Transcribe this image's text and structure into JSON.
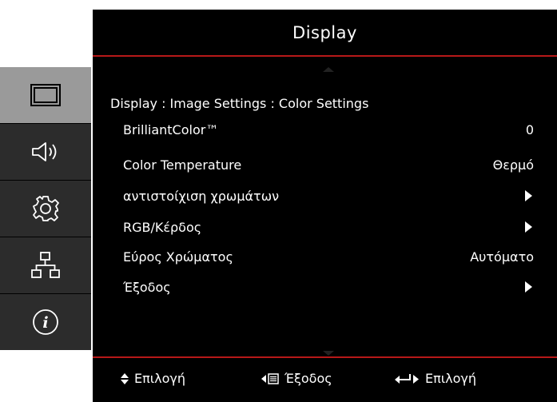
{
  "header": {
    "title": "Display"
  },
  "breadcrumb": "Display : Image Settings : Color Settings",
  "menu": [
    {
      "label": "BrilliantColor™",
      "value": "0",
      "submenu": false
    },
    {
      "label": "Color Temperature",
      "value": "Θερμό",
      "submenu": false
    },
    {
      "label": "αντιστοίχιση χρωμάτων",
      "value": "",
      "submenu": true
    },
    {
      "label": "RGB/Κέρδος",
      "value": "",
      "submenu": true
    },
    {
      "label": "Εύρος Χρώματος",
      "value": "Αυτόματο",
      "submenu": false
    },
    {
      "label": "Έξοδος",
      "value": "",
      "submenu": true
    }
  ],
  "footer": {
    "select_label": "Επιλογή",
    "exit_label": "Έξοδος",
    "enter_label": "Επιλογή"
  },
  "sidebar": {
    "items": [
      {
        "icon": "display-icon",
        "active": true
      },
      {
        "icon": "speaker-icon",
        "active": false
      },
      {
        "icon": "gear-icon",
        "active": false
      },
      {
        "icon": "network-icon",
        "active": false
      },
      {
        "icon": "info-icon",
        "active": false
      }
    ]
  },
  "colors": {
    "accent_red": "#b71818",
    "active_tab": "#9a9a9a",
    "tab_bg": "#2c2c2c"
  }
}
